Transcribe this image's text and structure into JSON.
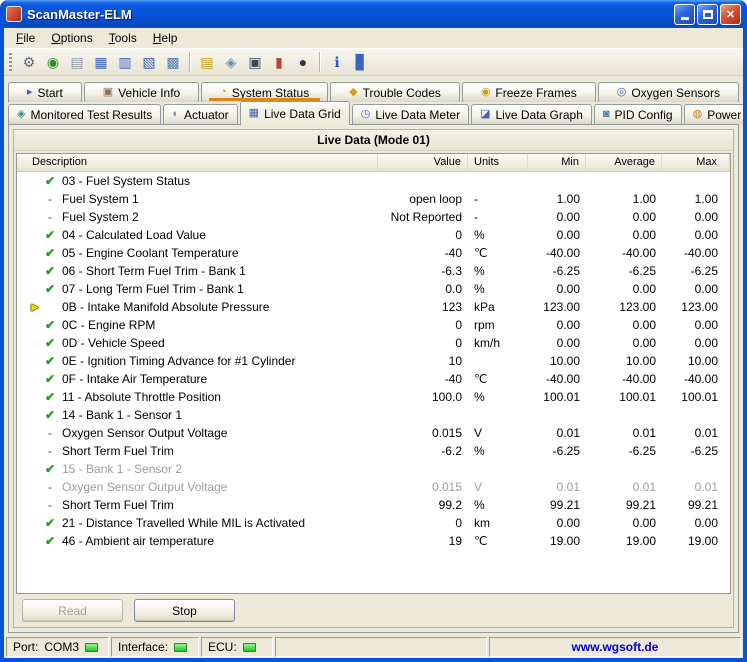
{
  "window": {
    "title": "ScanMaster-ELM",
    "close_glyph": "✕"
  },
  "menu": {
    "items": [
      "File",
      "Options",
      "Tools",
      "Help"
    ]
  },
  "toolbar": {
    "items": [
      {
        "name": "interface-tools-icon",
        "glyph": "⚙",
        "color": "#5A6B7B"
      },
      {
        "name": "globe-icon",
        "glyph": "◉",
        "color": "#2F8F2F"
      },
      {
        "name": "vehicle-info-icon",
        "glyph": "▤",
        "color": "#8A97A8"
      },
      {
        "name": "live-data-grid-icon",
        "glyph": "▦",
        "color": "#3A62C0"
      },
      {
        "name": "live-data-meter-icon",
        "glyph": "▥",
        "color": "#3A62C0"
      },
      {
        "name": "live-data-graph-icon",
        "glyph": "▧",
        "color": "#3A62C0"
      },
      {
        "name": "pid-config-icon",
        "glyph": "▩",
        "color": "#4A7AB5"
      },
      {
        "type": "sep"
      },
      {
        "name": "trouble-codes-icon",
        "glyph": "▤",
        "color": "#C8A018"
      },
      {
        "name": "freeze-frames-icon",
        "glyph": "◈",
        "color": "#6B8BB5"
      },
      {
        "name": "monitor-icon",
        "glyph": "▣",
        "color": "#3A4A5A"
      },
      {
        "name": "thermometer-icon",
        "glyph": "▮",
        "color": "#B5483A"
      },
      {
        "name": "oxygen-sensor-icon",
        "glyph": "●",
        "color": "#2A3A4A"
      },
      {
        "type": "sep"
      },
      {
        "name": "info-icon",
        "glyph": "ℹ",
        "color": "#2A5AD0"
      },
      {
        "name": "statistics-icon",
        "glyph": "▊",
        "color": "#3A62C0"
      }
    ]
  },
  "tabs_row1": [
    {
      "id": "start",
      "label": "Start",
      "icon": "▸",
      "icon_color": "#3A62C0"
    },
    {
      "id": "vehicle-info",
      "label": "Vehicle Info",
      "icon": "▣",
      "icon_color": "#8B6B4A"
    },
    {
      "id": "system-status",
      "label": "System Status",
      "icon": "◔",
      "icon_color": "#C8A018",
      "marked": true
    },
    {
      "id": "trouble-codes",
      "label": "Trouble Codes",
      "icon": "◆",
      "icon_color": "#D4A017"
    },
    {
      "id": "freeze-frames",
      "label": "Freeze Frames",
      "icon": "◉",
      "icon_color": "#C8A018"
    },
    {
      "id": "oxygen-sensors",
      "label": "Oxygen Sensors",
      "icon": "◎",
      "icon_color": "#3A62C0"
    }
  ],
  "tabs_row2": [
    {
      "id": "monitored-test-results",
      "label": "Monitored Test Results",
      "icon": "◈",
      "icon_color": "#2F8F8F"
    },
    {
      "id": "actuator",
      "label": "Actuator",
      "icon": "◐",
      "icon_color": "#7B8B9B"
    },
    {
      "id": "live-data-grid",
      "label": "Live Data Grid",
      "icon": "▦",
      "icon_color": "#3A62C0",
      "active": true
    },
    {
      "id": "live-data-meter",
      "label": "Live Data Meter",
      "icon": "◷",
      "icon_color": "#3A62C0"
    },
    {
      "id": "live-data-graph",
      "label": "Live Data Graph",
      "icon": "◪",
      "icon_color": "#3A62C0"
    },
    {
      "id": "pid-config",
      "label": "PID Config",
      "icon": "◙",
      "icon_color": "#4A7AB5"
    },
    {
      "id": "power",
      "label": "Power",
      "icon": "◍",
      "icon_color": "#C87818"
    }
  ],
  "panel": {
    "title": "Live Data (Mode 01)"
  },
  "table": {
    "headers": [
      "Description",
      "Value",
      "Units",
      "Min",
      "Average",
      "Max"
    ],
    "rows": [
      {
        "icon": "check",
        "description": "03 - Fuel System Status",
        "value": "",
        "units": "",
        "min": "",
        "average": "",
        "max": ""
      },
      {
        "icon": "dash",
        "description": "Fuel System 1",
        "value": "open loop",
        "units": "-",
        "min": "1.00",
        "average": "1.00",
        "max": "1.00"
      },
      {
        "icon": "dash",
        "description": "Fuel System 2",
        "value": "Not Reported",
        "units": "-",
        "min": "0.00",
        "average": "0.00",
        "max": "0.00"
      },
      {
        "icon": "check",
        "description": "04 - Calculated Load Value",
        "value": "0",
        "units": "%",
        "min": "0.00",
        "average": "0.00",
        "max": "0.00"
      },
      {
        "icon": "check",
        "description": "05 - Engine Coolant Temperature",
        "value": "-40",
        "units": "℃",
        "min": "-40.00",
        "average": "-40.00",
        "max": "-40.00"
      },
      {
        "icon": "check",
        "description": "06 - Short Term Fuel Trim - Bank 1",
        "value": "-6.3",
        "units": "%",
        "min": "-6.25",
        "average": "-6.25",
        "max": "-6.25"
      },
      {
        "icon": "check",
        "description": "07 - Long Term Fuel Trim - Bank 1",
        "value": "0.0",
        "units": "%",
        "min": "0.00",
        "average": "0.00",
        "max": "0.00"
      },
      {
        "icon": "arrow",
        "description": "0B - Intake Manifold Absolute Pressure",
        "value": "123",
        "units": "kPa",
        "min": "123.00",
        "average": "123.00",
        "max": "123.00"
      },
      {
        "icon": "check",
        "description": "0C - Engine RPM",
        "value": "0",
        "units": "rpm",
        "min": "0.00",
        "average": "0.00",
        "max": "0.00"
      },
      {
        "icon": "check",
        "description": "0D - Vehicle Speed",
        "value": "0",
        "units": "km/h",
        "min": "0.00",
        "average": "0.00",
        "max": "0.00"
      },
      {
        "icon": "check",
        "description": "0E - Ignition Timing Advance for #1 Cylinder",
        "value": "10",
        "units": "",
        "min": "10.00",
        "average": "10.00",
        "max": "10.00"
      },
      {
        "icon": "check",
        "description": "0F - Intake Air Temperature",
        "value": "-40",
        "units": "℃",
        "min": "-40.00",
        "average": "-40.00",
        "max": "-40.00"
      },
      {
        "icon": "check",
        "description": "11 - Absolute Throttle Position",
        "value": "100.0",
        "units": "%",
        "min": "100.01",
        "average": "100.01",
        "max": "100.01"
      },
      {
        "icon": "check",
        "description": "14 - Bank 1 - Sensor 1",
        "value": "",
        "units": "",
        "min": "",
        "average": "",
        "max": ""
      },
      {
        "icon": "dash",
        "description": "Oxygen Sensor Output Voltage",
        "value": "0.015",
        "units": "V",
        "min": "0.01",
        "average": "0.01",
        "max": "0.01"
      },
      {
        "icon": "dash",
        "description": "Short Term Fuel Trim",
        "value": "-6.2",
        "units": "%",
        "min": "-6.25",
        "average": "-6.25",
        "max": "-6.25"
      },
      {
        "icon": "check",
        "description": "15 - Bank 1 - Sensor 2",
        "value": "",
        "units": "",
        "min": "",
        "average": "",
        "max": "",
        "dim": true
      },
      {
        "icon": "dash",
        "description": "Oxygen Sensor Output Voltage",
        "value": "0.015",
        "units": "V",
        "min": "0.01",
        "average": "0.01",
        "max": "0.01",
        "dim": true
      },
      {
        "icon": "dash",
        "description": "Short Term Fuel Trim",
        "value": "99.2",
        "units": "%",
        "min": "99.21",
        "average": "99.21",
        "max": "99.21"
      },
      {
        "icon": "check",
        "description": "21 - Distance Travelled While MIL is Activated",
        "value": "0",
        "units": "km",
        "min": "0.00",
        "average": "0.00",
        "max": "0.00"
      },
      {
        "icon": "check",
        "description": "46 - Ambient air temperature",
        "value": "19",
        "units": "℃",
        "min": "19.00",
        "average": "19.00",
        "max": "19.00"
      }
    ]
  },
  "icon_glyphs": {
    "check": "✔",
    "dash": "-",
    "arrow": "►"
  },
  "buttons": {
    "read": "Read",
    "stop": "Stop"
  },
  "statusbar": {
    "port_label": "Port:",
    "port_value": "COM3",
    "interface_label": "Interface:",
    "ecu_label": "ECU:",
    "website": "www.wgsoft.de"
  },
  "colors": {
    "titlebar_blue": "#0A55DD",
    "status_led_green": "#2FC82F",
    "website_blue": "#0000CC",
    "check_green": "#18A018",
    "row_cursor_yellow": "#F2D600",
    "tab_marker_orange": "#D8881C"
  }
}
